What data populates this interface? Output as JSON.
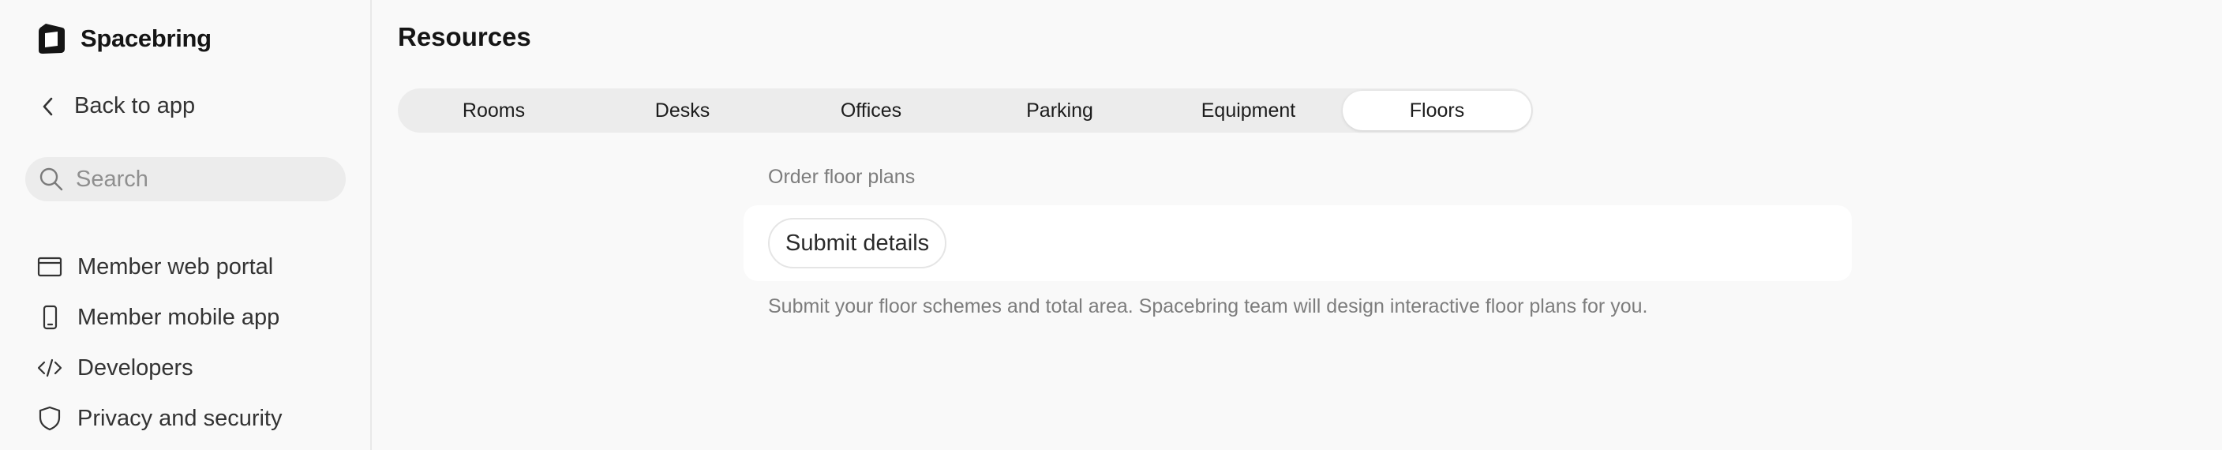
{
  "brand": {
    "name": "Spacebring",
    "logo_icon": "spacebring-logo-icon"
  },
  "sidebar": {
    "back_label": "Back to app",
    "search_placeholder": "Search",
    "items": [
      {
        "label": "Member web portal",
        "icon": "browser-window-icon"
      },
      {
        "label": "Member mobile app",
        "icon": "mobile-phone-icon"
      },
      {
        "label": "Developers",
        "icon": "code-icon"
      },
      {
        "label": "Privacy and security",
        "icon": "shield-icon"
      }
    ]
  },
  "main": {
    "title": "Resources",
    "tabs": [
      {
        "label": "Rooms",
        "active": false
      },
      {
        "label": "Desks",
        "active": false
      },
      {
        "label": "Offices",
        "active": false
      },
      {
        "label": "Parking",
        "active": false
      },
      {
        "label": "Equipment",
        "active": false
      },
      {
        "label": "Floors",
        "active": true
      }
    ],
    "section_label": "Order floor plans",
    "submit_button_label": "Submit details",
    "help_text": "Submit your floor schemes and total area. Spacebring team will design interactive floor plans for you."
  },
  "colors": {
    "background": "#f9f9f9",
    "sidebar_border": "#e9e9e9",
    "tabbar_bg": "#ececec",
    "active_tab_bg": "#ffffff",
    "muted_text": "#7d7d7d",
    "primary_text": "#1c1c1c"
  }
}
